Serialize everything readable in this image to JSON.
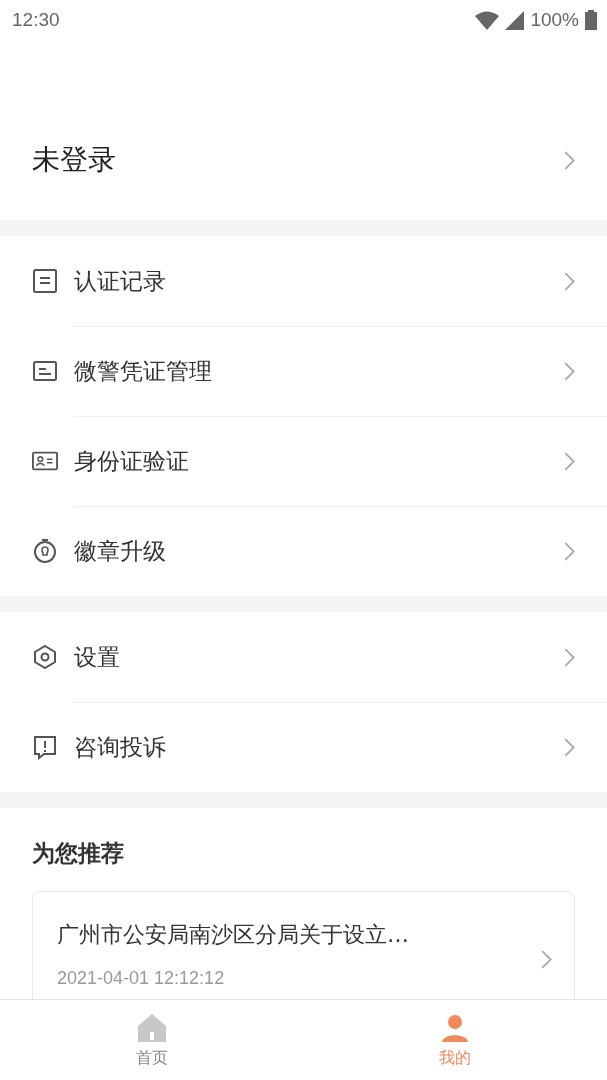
{
  "status_bar": {
    "time": "12:30",
    "battery": "100%"
  },
  "account": {
    "label": "未登录"
  },
  "menu_groups": [
    {
      "items": [
        {
          "kind": "document",
          "label": "认证记录"
        },
        {
          "kind": "certificate",
          "label": "微警凭证管理"
        },
        {
          "kind": "id-card",
          "label": "身份证验证"
        },
        {
          "kind": "badge",
          "label": "徽章升级"
        }
      ]
    },
    {
      "items": [
        {
          "kind": "settings",
          "label": "设置"
        },
        {
          "kind": "alert",
          "label": "咨询投诉"
        }
      ]
    }
  ],
  "recommend": {
    "title": "为您推荐",
    "articles": [
      {
        "title": "广州市公安局南沙区分局关于设立…",
        "time": "2021-04-01 12:12:12"
      }
    ]
  },
  "tab_bar": [
    {
      "kind": "home",
      "label": "首页",
      "selected": false
    },
    {
      "kind": "person",
      "label": "我的",
      "selected": true
    }
  ]
}
